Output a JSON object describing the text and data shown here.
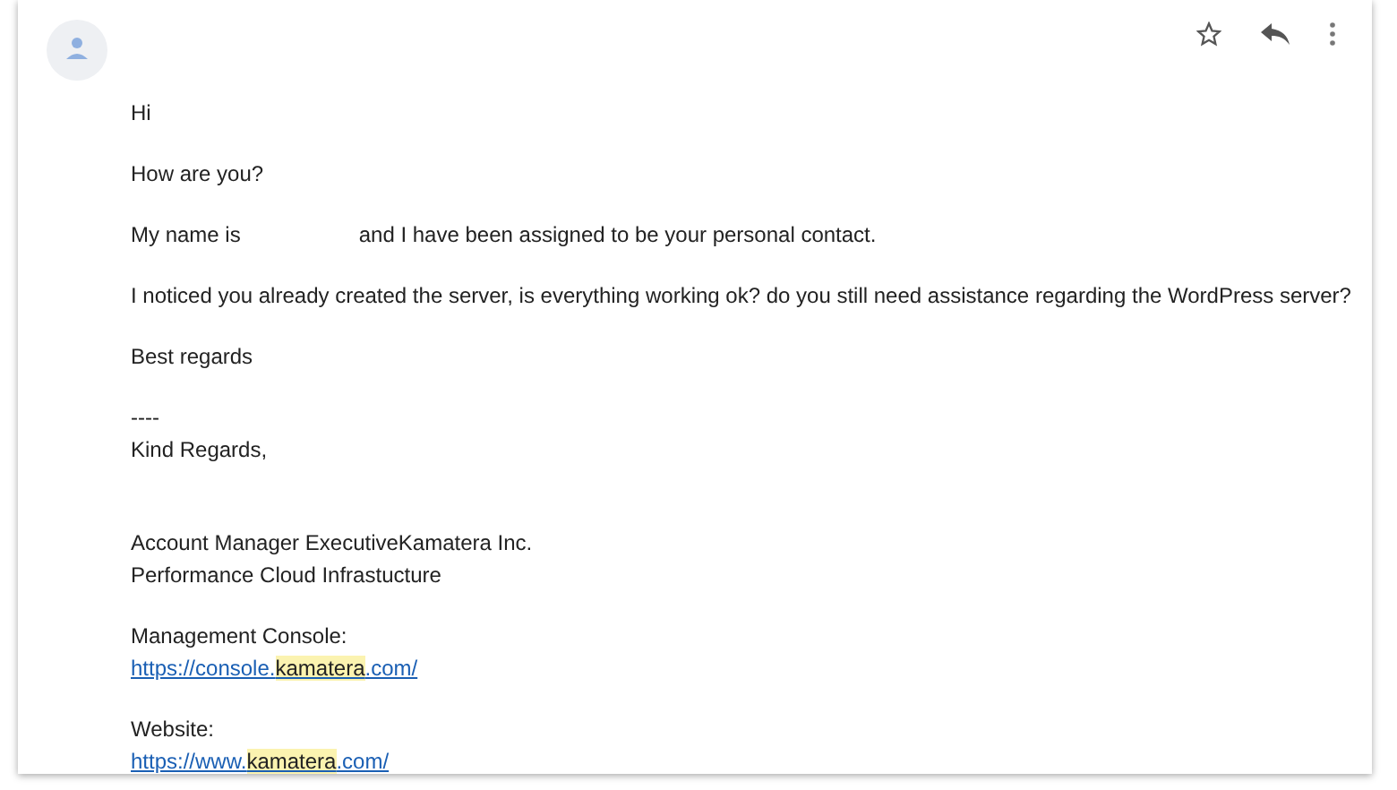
{
  "message": [
    [
      {
        "kind": "text",
        "text": "Hi"
      }
    ],
    [
      {
        "kind": "text",
        "text": "How are you?"
      }
    ],
    [
      {
        "kind": "split",
        "parts": [
          "My name is",
          "and I have been assigned to be your personal contact."
        ]
      }
    ],
    [
      {
        "kind": "text",
        "text": "I noticed you already created the server, is everything working ok? do you still need assistance regarding the WordPress server?"
      }
    ],
    [
      {
        "kind": "text",
        "text": "Best regards"
      }
    ],
    [
      {
        "kind": "text",
        "text": "----"
      },
      {
        "kind": "text",
        "text": "Kind Regards,"
      }
    ]
  ],
  "signature": [
    [
      {
        "kind": "text",
        "text": "Account Manager ExecutiveKamatera Inc."
      },
      {
        "kind": "text",
        "text": "Performance Cloud Infrastucture"
      }
    ],
    [
      {
        "kind": "text",
        "text": "Management Console:"
      },
      {
        "kind": "link",
        "before": "https://console.",
        "highlight": "kamatera",
        "after": ".com/"
      }
    ],
    [
      {
        "kind": "text",
        "text": "Website:"
      },
      {
        "kind": "link",
        "before": "https://www.",
        "highlight": "kamatera",
        "after": ".com/"
      }
    ]
  ]
}
